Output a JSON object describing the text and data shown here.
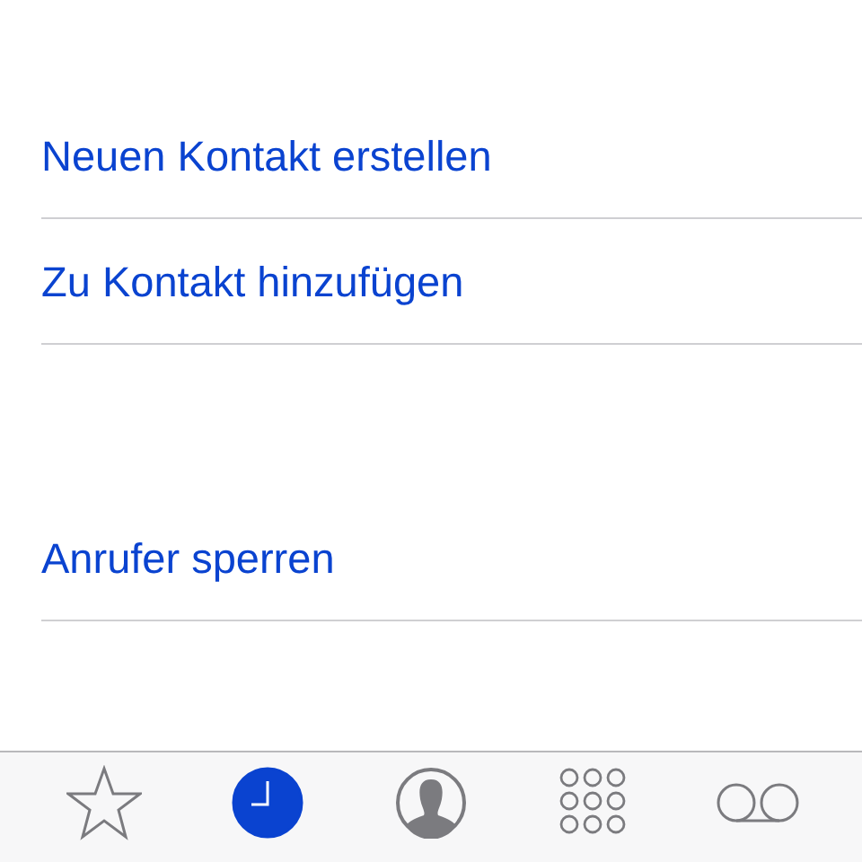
{
  "sections": [
    {
      "actions": [
        {
          "label": "Neuen Kontakt erstellen"
        },
        {
          "label": "Zu Kontakt hinzufügen"
        }
      ]
    },
    {
      "actions": [
        {
          "label": "Anrufer sperren"
        }
      ]
    }
  ],
  "tab_bar": [
    {
      "kind": "star",
      "selected": false
    },
    {
      "kind": "clock",
      "selected": true
    },
    {
      "kind": "person",
      "selected": false
    },
    {
      "kind": "keypad",
      "selected": false
    },
    {
      "kind": "voicemail",
      "selected": false
    }
  ]
}
